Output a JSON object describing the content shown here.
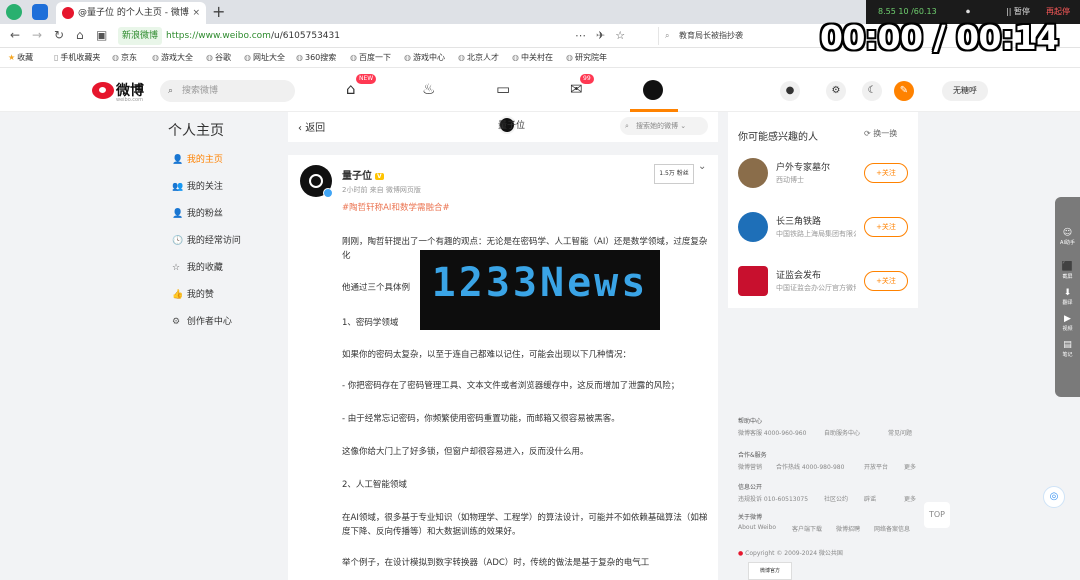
{
  "browser": {
    "tab_title": "@量子位 的个人主页 - 微博",
    "tab_close": "×",
    "new_tab": "+",
    "sys_status": "8.55 10 /60.13",
    "sys_mic": "⏺",
    "sys_pause": "|| 暂停",
    "sys_stop": "再起停",
    "secure_badge": "新浪微博",
    "url_scheme": "https://",
    "url_domain": "www.weibo.com",
    "url_path": "/u/6105753431",
    "search_text": "教育局长被指抄袭",
    "bookmarks": [
      "收藏",
      "手机收藏夹",
      "京东",
      "游戏大全",
      "谷歌",
      "网址大全",
      "360搜索",
      "百度一下",
      "游戏中心",
      "北京人才",
      "中关村在",
      "研究院年"
    ]
  },
  "timer": "00:00 / 00:14",
  "weibo_nav": {
    "logo_text": "微博",
    "logo_sub": "weibo.com",
    "search_placeholder": "搜索微博",
    "new_badge": "NEW",
    "msg_badge": "99",
    "user_name": "无糖呼"
  },
  "sidebar": {
    "title": "个人主页",
    "items": [
      {
        "icon": "👤",
        "label": "我的主页"
      },
      {
        "icon": "👥",
        "label": "我的关注"
      },
      {
        "icon": "👤",
        "label": "我的粉丝"
      },
      {
        "icon": "🕓",
        "label": "我的经常访问"
      },
      {
        "icon": "☆",
        "label": "我的收藏"
      },
      {
        "icon": "👍",
        "label": "我的赞"
      },
      {
        "icon": "⚙",
        "label": "创作者中心"
      }
    ]
  },
  "middle_header": {
    "back_label": "返回",
    "profile_name": "量子位",
    "search_placeholder": "搜索她的微博"
  },
  "post": {
    "author": "量子位",
    "vip_badge": "V",
    "meta": "2小时前 来自 微博网页版",
    "follow_count": "1.5万 粉丝",
    "hashtag": "#陶哲轩称AI和数学需融合#",
    "para1": "刚刚，陶哲轩提出了一个有趣的观点：无论是在密码学、人工智能（AI）还是数学领域，过度复杂化",
    "para2": "他通过三个具体例",
    "para3": "1、密码学领域",
    "para4": "如果你的密码太复杂，以至于连自己都难以记住，可能会出现以下几种情况：",
    "para5": "- 你把密码存在了密码管理工具、文本文件或者浏览器缓存中，这反而增加了泄露的风险；",
    "para6": "- 由于经常忘记密码，你频繁使用密码重置功能，而邮箱又很容易被黑客。",
    "para7": "这像你给大门上了好多锁，但窗户却很容易进入，反而没什么用。",
    "para8": "2、人工智能领域",
    "para9": "在AI领域，很多基于专业知识（如物理学、工程学）的算法设计，可能并不如依赖基础算法（如梯度下降、反向传播等）和大数据训练的效果好。",
    "para10": "举个例子，在设计模拟到数字转换器（ADC）时，传统的做法是基于复杂的电气工"
  },
  "news_overlay": "1233News",
  "suggestions": {
    "title": "你可能感兴趣的人",
    "refresh": "换一换",
    "follow_label": "+关注",
    "items": [
      {
        "name": "户外专家墓尔",
        "desc": "西动博士",
        "color": "#8a6d4a"
      },
      {
        "name": "长三角铁路",
        "desc": "中国铁路上海局集团有限公司",
        "color": "#1e6fb8"
      },
      {
        "name": "证监会发布",
        "desc": "中国证监会办公厅官方微博",
        "color": "#c8102e"
      }
    ]
  },
  "footer": {
    "rows": [
      {
        "head": "帮助中心",
        "cols": [
          "微博客服 4000-960-960",
          "自助服务中心",
          "常见问题"
        ]
      },
      {
        "head": "合作&服务",
        "cols": [
          "微博营销",
          "合作热线 4000-980-980",
          "开放平台",
          "更多"
        ]
      },
      {
        "head": "信息公开",
        "cols": [
          "违规投诉 010-60513075",
          "社区公约",
          "辟谣",
          "更多"
        ]
      },
      {
        "head": "关于微博",
        "cols": [
          "About Weibo",
          "客户端下载",
          "微博招聘",
          "网络备案信息"
        ]
      }
    ],
    "copyright": "Copyright © 2009-2024 微公共国",
    "qr_label": "微博官方"
  },
  "totop_label": "TOP",
  "side_tools": [
    {
      "icon": "☺",
      "label": "AI助手"
    },
    {
      "icon": "⬛",
      "label": "截屏"
    },
    {
      "icon": "⬇",
      "label": "翻译"
    },
    {
      "icon": "▶",
      "label": "视频"
    },
    {
      "icon": "▤",
      "label": "笔记"
    }
  ]
}
